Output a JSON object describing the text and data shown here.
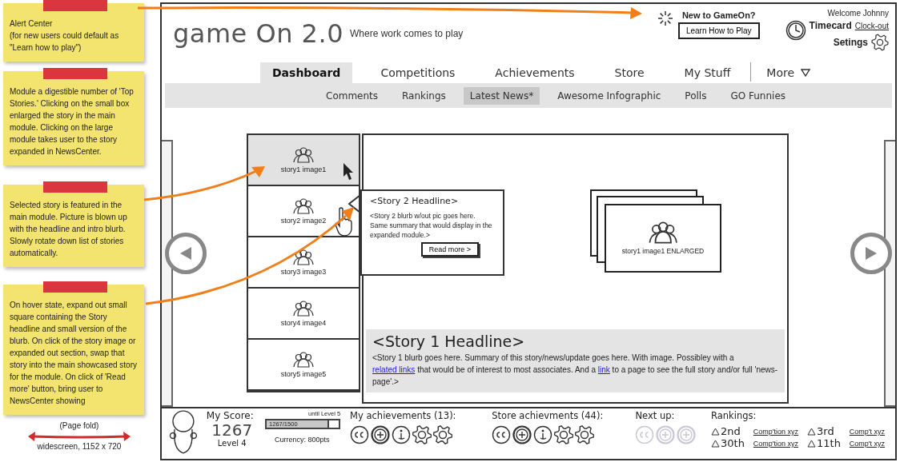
{
  "notes": [
    {
      "text": "Alert Center\n(for new users could default as \"Learn how to play\")"
    },
    {
      "text": "Module a digestible number of 'Top Stories.'  Clicking on the small box enlarged the story in the main module. Clicking on the large module takes user to the story expanded in NewsCenter."
    },
    {
      "text": "Selected story is featured in the main module. Picture is blown up with the headline and intro blurb. Slowly rotate down list of stories automatically."
    },
    {
      "text": "On hover state, expand out small square containing the Story headline and small version of the blurb.  On click of the story image or expanded out section, swap that story into the main showcased story for the module. On click of 'Read more' button, bring user to NewsCenter showing"
    }
  ],
  "page_fold": {
    "label": "(Page fold)",
    "size": "widescreen, 1152 x 720"
  },
  "header": {
    "logo": "game On 2.0",
    "tagline": "Where work comes to play",
    "alert": {
      "title": "New to GameOn?",
      "button": "Learn How to Play"
    },
    "user": {
      "welcome": "Welcome Johnny",
      "timecard": "Timecard",
      "clock_out": "Clock-out",
      "settings": "Setings"
    }
  },
  "tabs": [
    {
      "label": "Dashboard",
      "selected": true,
      "kind": "tab"
    },
    {
      "label": "Competitions",
      "selected": false,
      "kind": "tab"
    },
    {
      "label": "Achievements",
      "selected": false,
      "kind": "tab"
    },
    {
      "label": "Store",
      "selected": false,
      "kind": "tab"
    },
    {
      "label": "My Stuff",
      "selected": false,
      "kind": "tab"
    },
    {
      "label": "More",
      "selected": false,
      "kind": "menu"
    }
  ],
  "subtabs": [
    {
      "label": "Comments",
      "selected": false
    },
    {
      "label": "Rankings",
      "selected": false
    },
    {
      "label": "Latest News*",
      "selected": true
    },
    {
      "label": "Awesome Infographic",
      "selected": false
    },
    {
      "label": "Polls",
      "selected": false
    },
    {
      "label": "GO Funnies",
      "selected": false
    }
  ],
  "stories": [
    {
      "label": "story1 image1",
      "selected": true
    },
    {
      "label": "story2 image2",
      "selected": false
    },
    {
      "label": "story3 image3",
      "selected": false
    },
    {
      "label": "story4 image4",
      "selected": false
    },
    {
      "label": "story5 image5",
      "selected": false
    }
  ],
  "hover_card": {
    "headline": "<Story 2 Headline>",
    "blurb": "<Story 2 blurb w/out pic goes here.  Same summary that would display in the expanded module.>",
    "button": "Read more >"
  },
  "featured": {
    "image_caption": "story1 image1 ENLARGED",
    "headline": "<Story 1 Headline>",
    "blurb": [
      {
        "text": "<Story 1 blurb goes here. Summary of this story/news/update goes here. With image. Possibley with a ",
        "kind": "text"
      },
      {
        "text": "related links",
        "kind": "link"
      },
      {
        "text": " that would be of interest to most associates. And a ",
        "kind": "text"
      },
      {
        "text": "link",
        "kind": "link"
      },
      {
        "text": " to a page to see the full story and/or full 'news-page'.>",
        "kind": "text"
      }
    ]
  },
  "footer": {
    "score": {
      "label": "My Score:",
      "value": "1267",
      "level_label": "Level 4",
      "next_level": "until Level 5",
      "progress": {
        "label": "1267/1500",
        "level": 0.844
      },
      "currency": "Currency: 800pts"
    },
    "achievements": {
      "title": "My achievements (13):",
      "badges": [
        {
          "kind": "cc",
          "locked": false
        },
        {
          "kind": "plus",
          "locked": false
        },
        {
          "kind": "info",
          "locked": false
        },
        {
          "kind": "gear",
          "locked": false
        },
        {
          "kind": "gear",
          "locked": false
        }
      ]
    },
    "store": {
      "title": "Store achievments (44):",
      "badges": [
        {
          "kind": "cc",
          "locked": false
        },
        {
          "kind": "plus",
          "locked": false
        },
        {
          "kind": "info",
          "locked": false
        },
        {
          "kind": "gear",
          "locked": false
        },
        {
          "kind": "gear",
          "locked": false
        }
      ]
    },
    "next_up": {
      "title": "Next up:",
      "badges": [
        {
          "kind": "cc",
          "locked": true
        },
        {
          "kind": "plus",
          "locked": true
        },
        {
          "kind": "plus",
          "locked": true
        }
      ]
    },
    "rankings": {
      "title": "Rankings:",
      "items": [
        {
          "rank": "2nd",
          "competition": "Comp'tion xyz"
        },
        {
          "rank": "3rd",
          "competition": "Comp't xyz"
        },
        {
          "rank": "30th",
          "competition": "Comp'tion xyz"
        },
        {
          "rank": "11th",
          "competition": "Comp't xyz"
        }
      ]
    }
  }
}
